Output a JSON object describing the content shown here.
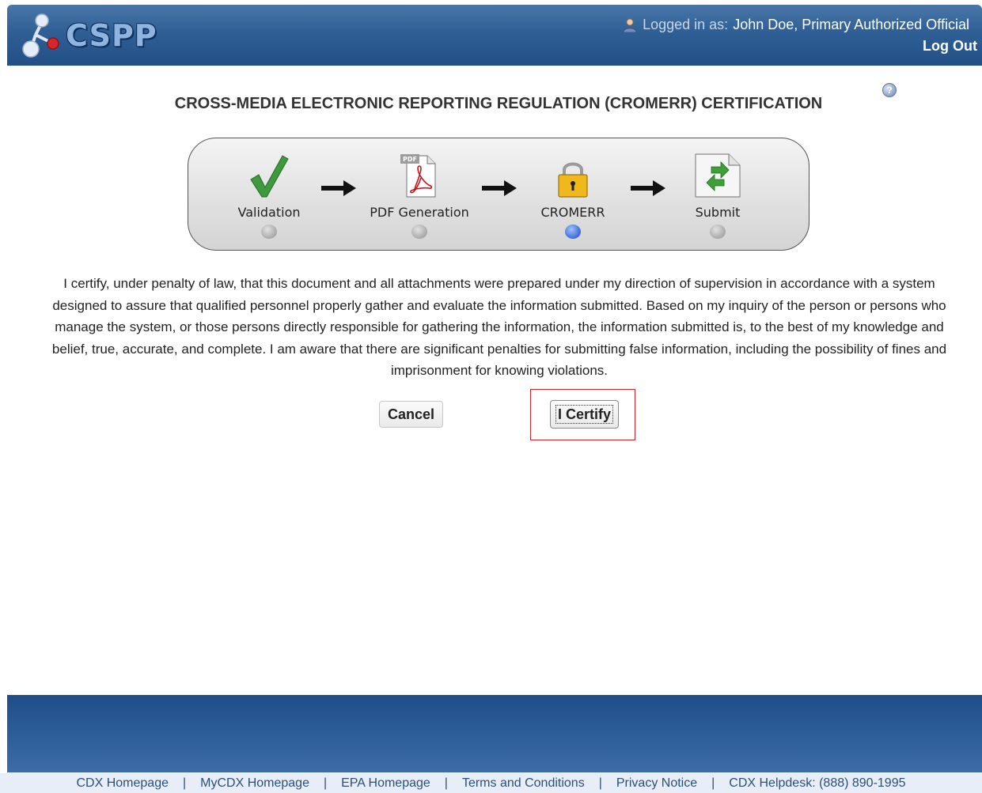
{
  "header": {
    "logo_text": "CSPP",
    "logged_in_label": "Logged in as:",
    "user_name": "John Doe, Primary Authorized Official",
    "logout_label": "Log Out"
  },
  "page": {
    "title": "CROSS-MEDIA ELECTRONIC REPORTING REGULATION (CROMERR) CERTIFICATION",
    "help_icon": "help-icon"
  },
  "stepper": {
    "steps": [
      {
        "label": "Validation",
        "icon": "checkmark-icon",
        "active": false
      },
      {
        "label": "PDF Generation",
        "icon": "pdf-icon",
        "active": false
      },
      {
        "label": "CROMERR",
        "icon": "lock-icon",
        "active": true
      },
      {
        "label": "Submit",
        "icon": "submit-document-icon",
        "active": false
      }
    ]
  },
  "certification": {
    "text": "I certify, under penalty of law, that this document and all attachments were prepared under my direction of supervision in accordance with a system designed to assure that qualified personnel properly gather and evaluate the information submitted. Based on my inquiry of the person or persons who manage the system, or those persons directly responsible for gathering the information, the information submitted is, to the best of my knowledge and belief, true, accurate, and complete. I am aware that there are significant penalties for submitting false information, including the possibility of fines and imprisonment for knowing violations."
  },
  "buttons": {
    "cancel_label": "Cancel",
    "certify_label": "I Certify"
  },
  "footer": {
    "links": [
      "CDX Homepage",
      "MyCDX Homepage",
      "EPA Homepage",
      "Terms and Conditions",
      "Privacy Notice",
      "CDX Helpdesk: (888) 890-1995"
    ],
    "separator": "|"
  },
  "colors": {
    "header_blue": "#2f5f95",
    "active_step_dot": "#1445c4",
    "highlight_red": "#d2232a"
  }
}
